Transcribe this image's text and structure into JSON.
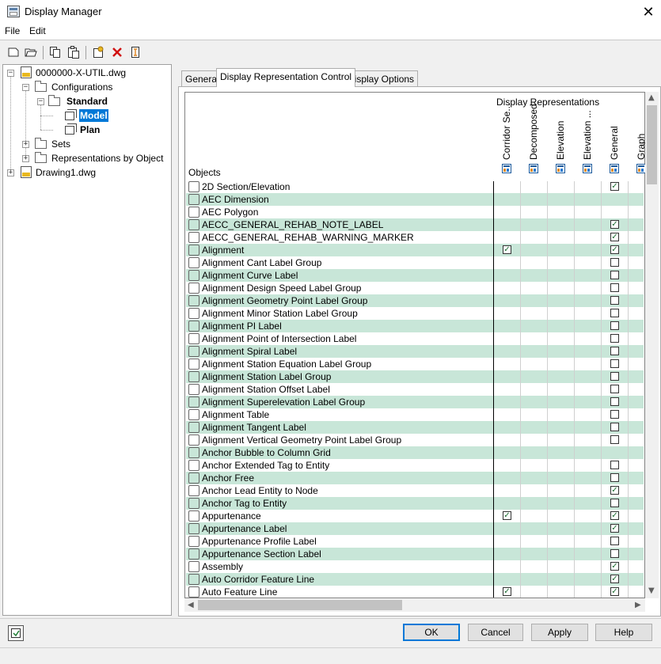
{
  "window": {
    "title": "Display Manager",
    "close_glyph": "✕"
  },
  "menu": {
    "file": "File",
    "edit": "Edit"
  },
  "toolbar": {
    "icons": [
      "new-icon",
      "open-icon",
      "copy-icon",
      "paste-icon",
      "new-rep-icon",
      "delete-icon",
      "rename-icon"
    ]
  },
  "tree": {
    "root": "0000000-X-UTIL.dwg",
    "configurations": "Configurations",
    "standard": "Standard",
    "model": "Model",
    "plan": "Plan",
    "sets": "Sets",
    "reps_by_object": "Representations by Object",
    "drawing1": "Drawing1.dwg"
  },
  "tabs": [
    {
      "label": "General"
    },
    {
      "label": "Display Representation Control"
    },
    {
      "label": "Display Options"
    }
  ],
  "grid": {
    "display_representations": "Display Representations",
    "objects_header": "Objects",
    "columns": [
      "Corridor Se...",
      "Decomposed",
      "Elevation",
      "Elevation ...",
      "General",
      "Graph"
    ],
    "rows": [
      {
        "label": "2D Section/Elevation",
        "corridor": false,
        "general": true
      },
      {
        "label": "AEC Dimension",
        "corridor": false,
        "general": null
      },
      {
        "label": "AEC Polygon",
        "corridor": false,
        "general": null
      },
      {
        "label": "AECC_GENERAL_REHAB_NOTE_LABEL",
        "corridor": false,
        "general": true
      },
      {
        "label": "AECC_GENERAL_REHAB_WARNING_MARKER",
        "corridor": false,
        "general": true
      },
      {
        "label": "Alignment",
        "corridor": true,
        "general": true
      },
      {
        "label": "Alignment Cant Label Group",
        "corridor": false,
        "general": false
      },
      {
        "label": "Alignment Curve Label",
        "corridor": false,
        "general": false
      },
      {
        "label": "Alignment Design Speed Label Group",
        "corridor": false,
        "general": false
      },
      {
        "label": "Alignment Geometry Point Label Group",
        "corridor": false,
        "general": false
      },
      {
        "label": "Alignment Minor Station Label Group",
        "corridor": false,
        "general": false
      },
      {
        "label": "Alignment PI Label",
        "corridor": false,
        "general": false
      },
      {
        "label": "Alignment Point of Intersection Label",
        "corridor": false,
        "general": false
      },
      {
        "label": "Alignment Spiral Label",
        "corridor": false,
        "general": false
      },
      {
        "label": "Alignment Station Equation Label Group",
        "corridor": false,
        "general": false
      },
      {
        "label": "Alignment Station Label Group",
        "corridor": false,
        "general": false
      },
      {
        "label": "Alignment Station Offset Label",
        "corridor": false,
        "general": false
      },
      {
        "label": "Alignment Superelevation Label Group",
        "corridor": false,
        "general": false
      },
      {
        "label": "Alignment Table",
        "corridor": false,
        "general": false
      },
      {
        "label": "Alignment Tangent Label",
        "corridor": false,
        "general": false
      },
      {
        "label": "Alignment Vertical Geometry Point Label Group",
        "corridor": false,
        "general": false
      },
      {
        "label": "Anchor Bubble to Column Grid",
        "corridor": false,
        "general": null
      },
      {
        "label": "Anchor Extended Tag to Entity",
        "corridor": false,
        "general": false
      },
      {
        "label": "Anchor Free",
        "corridor": false,
        "general": false
      },
      {
        "label": "Anchor Lead Entity to Node",
        "corridor": false,
        "general": true
      },
      {
        "label": "Anchor Tag to Entity",
        "corridor": false,
        "general": false
      },
      {
        "label": "Appurtenance",
        "corridor": true,
        "general": true
      },
      {
        "label": "Appurtenance Label",
        "corridor": false,
        "general": true
      },
      {
        "label": "Appurtenance Profile Label",
        "corridor": false,
        "general": false
      },
      {
        "label": "Appurtenance Section Label",
        "corridor": false,
        "general": false
      },
      {
        "label": "Assembly",
        "corridor": false,
        "general": true
      },
      {
        "label": "Auto Corridor Feature Line",
        "corridor": false,
        "general": true
      },
      {
        "label": "Auto Feature Line",
        "corridor": true,
        "general": true
      }
    ]
  },
  "buttons": {
    "ok": "OK",
    "cancel": "Cancel",
    "apply": "Apply",
    "help": "Help"
  }
}
